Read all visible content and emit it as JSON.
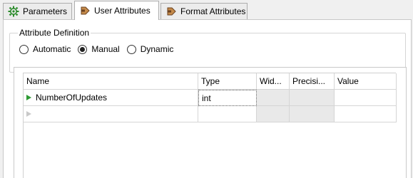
{
  "tabs": [
    {
      "label": "Parameters",
      "icon": "gear-icon",
      "active": false
    },
    {
      "label": "User Attributes",
      "icon": "attribute-icon",
      "active": true
    },
    {
      "label": "Format Attributes",
      "icon": "attribute-icon",
      "active": false
    }
  ],
  "attribute_definition": {
    "legend": "Attribute Definition",
    "options": [
      {
        "label": "Automatic",
        "checked": false
      },
      {
        "label": "Manual",
        "checked": true
      },
      {
        "label": "Dynamic",
        "checked": false
      }
    ]
  },
  "table": {
    "columns": [
      "Name",
      "Type",
      "Wid...",
      "Precisi...",
      "Value"
    ],
    "rows": [
      {
        "name": "NumberOfUpdates",
        "type": "int",
        "width": "",
        "precision": "",
        "value": ""
      },
      {
        "name": "",
        "type": "",
        "width": "",
        "precision": "",
        "value": ""
      }
    ]
  },
  "colors": {
    "gear_icon": "#2a8a2a",
    "attribute_icon": "#8a5a2b",
    "row_marker": "#2e9a34",
    "disabled_cell": "#e9e9e9"
  }
}
